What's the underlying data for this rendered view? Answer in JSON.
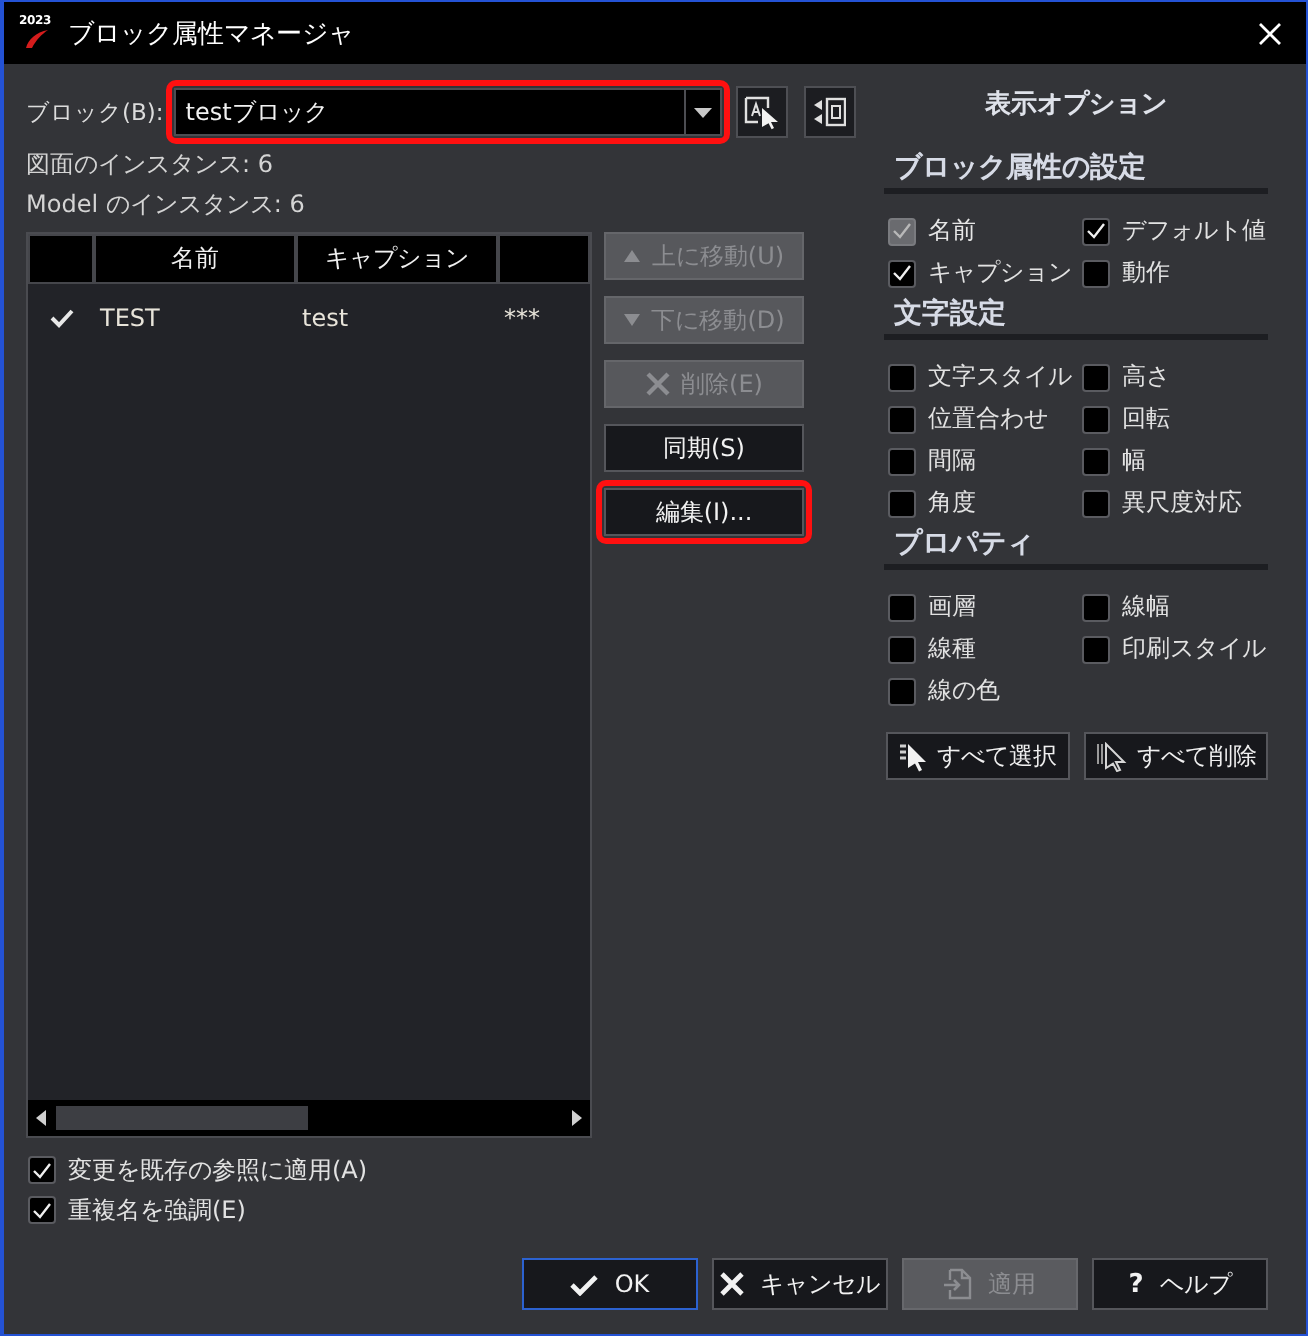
{
  "window": {
    "title": "ブロック属性マネージャ",
    "icon_text": "2023"
  },
  "block_field": {
    "label": "ブロック(B):",
    "value": "testブロック",
    "highlighted": true
  },
  "instances": [
    "図面のインスタンス: 6",
    "Model のインスタンス: 6"
  ],
  "table": {
    "columns": [
      {
        "kind": "check"
      },
      {
        "kind": "text",
        "label": "名前"
      },
      {
        "kind": "text",
        "label": "キャプション"
      },
      {
        "kind": "text"
      }
    ],
    "rows": [
      {
        "checked": true,
        "cells": [
          "TEST",
          "test",
          "***"
        ]
      }
    ]
  },
  "side_buttons": [
    {
      "label": "上に移動(U)",
      "kind": "up",
      "disabled": true,
      "highlighted": false
    },
    {
      "label": "下に移動(D)",
      "kind": "down",
      "disabled": true,
      "highlighted": false
    },
    {
      "label": "削除(E)",
      "kind": "delete",
      "disabled": true,
      "highlighted": false
    },
    {
      "label": "同期(S)",
      "kind": "plain",
      "disabled": false,
      "highlighted": false
    },
    {
      "label": "編集(I)...",
      "kind": "plain",
      "disabled": false,
      "highlighted": true
    }
  ],
  "options_panel": {
    "title": "表示オプション",
    "sections": [
      {
        "title": "ブロック属性の設定",
        "options": [
          {
            "label": "名前",
            "checked": true,
            "disabled": true
          },
          {
            "label": "デフォルト値",
            "checked": true,
            "disabled": false
          },
          {
            "label": "キャプション",
            "checked": true,
            "disabled": false
          },
          {
            "label": "動作",
            "checked": false,
            "disabled": false
          }
        ]
      },
      {
        "title": "文字設定",
        "options": [
          {
            "label": "文字スタイル",
            "checked": false,
            "disabled": false
          },
          {
            "label": "高さ",
            "checked": false,
            "disabled": false
          },
          {
            "label": "位置合わせ",
            "checked": false,
            "disabled": false
          },
          {
            "label": "回転",
            "checked": false,
            "disabled": false
          },
          {
            "label": "間隔",
            "checked": false,
            "disabled": false
          },
          {
            "label": "幅",
            "checked": false,
            "disabled": false
          },
          {
            "label": "角度",
            "checked": false,
            "disabled": false
          },
          {
            "label": "異尺度対応",
            "checked": false,
            "disabled": false
          }
        ]
      },
      {
        "title": "プロパティ",
        "options": [
          {
            "label": "画層",
            "checked": false,
            "disabled": false
          },
          {
            "label": "線幅",
            "checked": false,
            "disabled": false
          },
          {
            "label": "線種",
            "checked": false,
            "disabled": false
          },
          {
            "label": "印刷スタイル",
            "checked": false,
            "disabled": false
          },
          {
            "label": "線の色",
            "checked": false,
            "disabled": false
          }
        ]
      }
    ],
    "buttons": [
      {
        "label": "すべて選択",
        "kind": "select"
      },
      {
        "label": "すべて削除",
        "kind": "clear"
      }
    ]
  },
  "footer_options": [
    {
      "label": "変更を既存の参照に適用(A)",
      "checked": true
    },
    {
      "label": "重複名を強調(E)",
      "checked": true
    }
  ],
  "dialog_buttons": [
    {
      "label": "OK",
      "kind": "ok",
      "disabled": false,
      "focused": true
    },
    {
      "label": "キャンセル",
      "kind": "cancel",
      "disabled": false,
      "focused": false
    },
    {
      "label": "適用",
      "kind": "apply",
      "disabled": true,
      "focused": false
    },
    {
      "label": "ヘルプ",
      "kind": "help",
      "glyph": "?",
      "disabled": false,
      "focused": false
    }
  ]
}
